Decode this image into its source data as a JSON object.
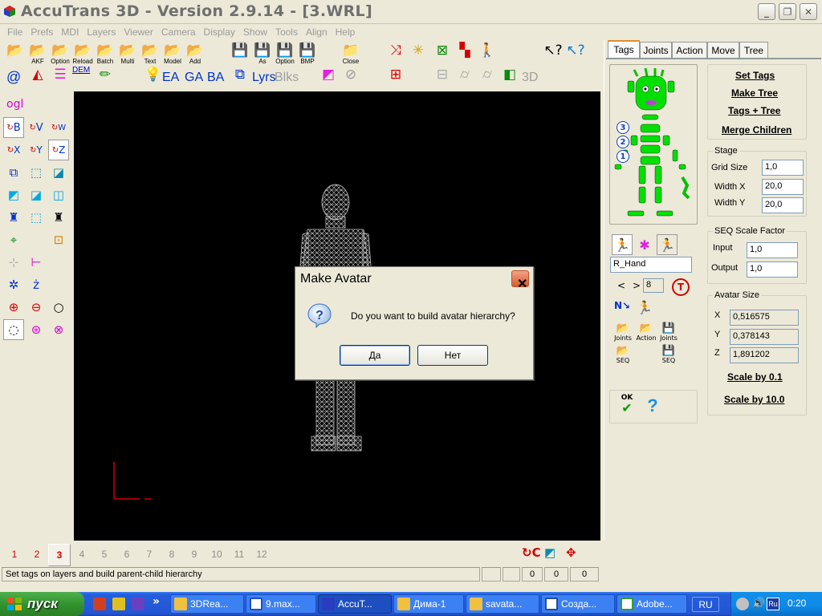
{
  "window": {
    "title": "AccuTrans 3D - Version 2.9.14 - [3.WRL]",
    "caption_buttons": {
      "minimize": "_",
      "maximize": "❐",
      "close": "✕"
    }
  },
  "menu": [
    "File",
    "Prefs",
    "MDI",
    "Layers",
    "Viewer",
    "Camera",
    "Display",
    "Show",
    "Tools",
    "Align",
    "Help"
  ],
  "toolbar": {
    "row1_labels": [
      "AKF",
      "Option",
      "Reload",
      "Batch",
      "Multi",
      "Text",
      "Model",
      "Add",
      "As",
      "Option",
      "BMP",
      "Close"
    ],
    "row2_text": {
      "at": "@",
      "dem": "DEM",
      "ea": "EA",
      "ga": "GA",
      "ba": "BA",
      "lyrs": "Lyrs",
      "blks": "Blks",
      "three_d": "3D"
    }
  },
  "left_tools": {
    "ogl": "ogl",
    "axes": [
      "B",
      "V",
      "W",
      "X",
      "Y",
      "Z"
    ]
  },
  "right_panel": {
    "tabs": [
      "Tags",
      "Joints",
      "Action",
      "Move",
      "Tree"
    ],
    "active_tab": "Tags",
    "commands": [
      "Set Tags",
      "Make Tree",
      "Tags + Tree",
      "Merge Children"
    ],
    "level_markers": [
      "3",
      "2",
      "1"
    ],
    "stage": {
      "title": "Stage",
      "grid_size_label": "Grid Size",
      "grid_size": "1,0",
      "width_x_label": "Width X",
      "width_x": "20,0",
      "width_y_label": "Width Y",
      "width_y": "20,0"
    },
    "seq_scale": {
      "title": "SEQ Scale Factor",
      "input_label": "Input",
      "input_value": "1,0",
      "output_label": "Output",
      "output_value": "1,0"
    },
    "avatar_size": {
      "title": "Avatar Size",
      "x_label": "X",
      "x_value": "0,516575",
      "y_label": "Y",
      "y_value": "0,378143",
      "z_label": "Z",
      "z_value": "1,891202",
      "scale_small": "Scale by 0.1",
      "scale_large": "Scale by 10.0"
    },
    "tag_name": "R_Hand",
    "nav": {
      "prev": "<",
      "next": ">",
      "index": "8"
    },
    "seq_buttons": {
      "joints_action_joints": [
        "Joints",
        "Action",
        "Joints"
      ],
      "seq_left": "SEQ",
      "seq_right": "SEQ"
    },
    "ok_label": "OK",
    "help_label": "?"
  },
  "dialog": {
    "title": "Make Avatar",
    "close_label": "✕",
    "message": "Do you want to build avatar hierarchy?",
    "yes_label": "Да",
    "no_label": "Нет"
  },
  "layers": {
    "numbers": [
      "1",
      "2",
      "3",
      "4",
      "5",
      "6",
      "7",
      "8",
      "9",
      "10",
      "11",
      "12"
    ],
    "selected": "3"
  },
  "status": {
    "message": "Set tags on layers and build parent-child hierarchy",
    "counters": [
      "0",
      "0",
      "0"
    ]
  },
  "taskbar": {
    "start_label": "пуск",
    "quick_more": "»",
    "tasks": [
      "3DRea...",
      "9.max...",
      "AccuT...",
      "Дима-1",
      "savata...",
      "Созда...",
      "Adobe..."
    ],
    "active_task": "AccuT...",
    "language": "RU",
    "tray_lang": "Ru",
    "clock": "0:20"
  },
  "colors": {
    "accent_green": "#00e000",
    "skeleton_bg": "#00ff00",
    "mesh": "#c8c8c8",
    "axis_red": "#d40000",
    "taskbar_blue": "#245edb",
    "start_green": "#3c9e36"
  }
}
